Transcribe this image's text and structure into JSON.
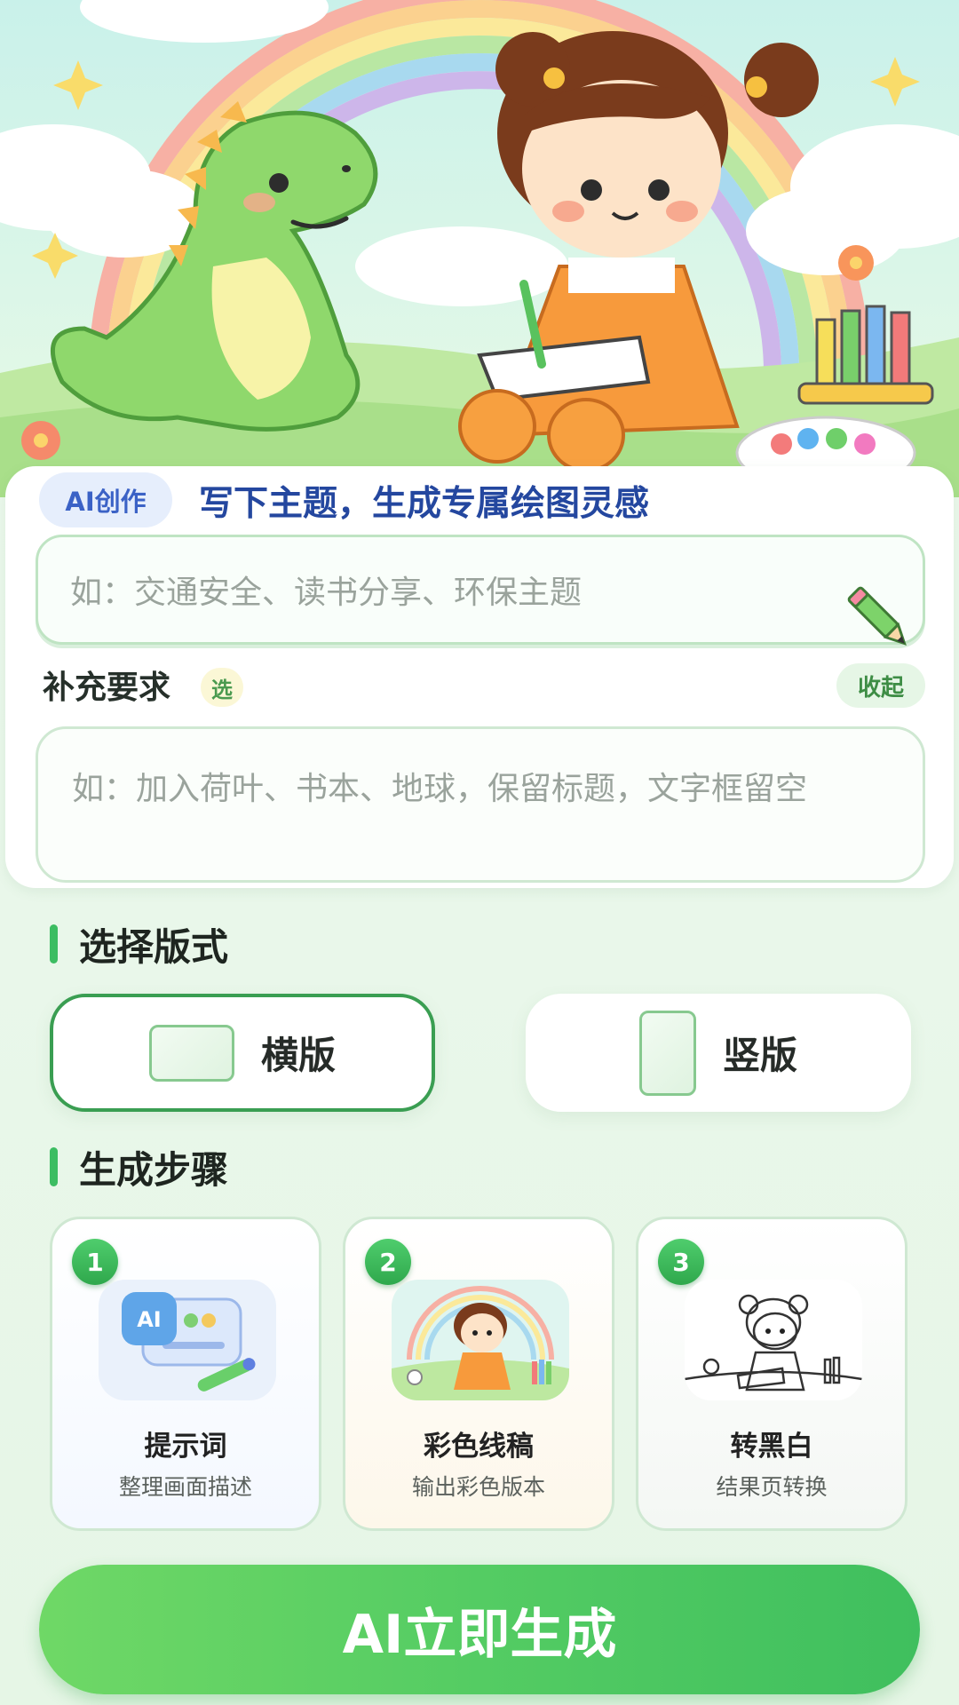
{
  "hero": {
    "scene": "cartoon-dinosaur-girl-drawing-rainbow"
  },
  "card": {
    "chip_label": "AI创作",
    "title": "写下主题，生成专属绘图灵感",
    "topic_placeholder": "如：交通安全、读书分享、环保主题",
    "extra_label": "补充要求",
    "optional_badge": "选",
    "collapse_label": "收起",
    "extra_placeholder": "如：加入荷叶、书本、地球，保留标题，文字框留空"
  },
  "layout_section": {
    "title": "选择版式",
    "options": [
      {
        "label": "横版",
        "selected": true
      },
      {
        "label": "竖版",
        "selected": false
      }
    ]
  },
  "steps_section": {
    "title": "生成步骤",
    "steps": [
      {
        "num": "1",
        "title": "提示词",
        "subtitle": "整理画面描述",
        "icon": "ai-prompt-icon",
        "ai_text": "AI"
      },
      {
        "num": "2",
        "title": "彩色线稿",
        "subtitle": "输出彩色版本",
        "icon": "color-drawing-thumbnail"
      },
      {
        "num": "3",
        "title": "转黑白",
        "subtitle": "结果页转换",
        "icon": "bw-drawing-thumbnail"
      }
    ]
  },
  "cta": {
    "label": "AI立即生成"
  },
  "colors": {
    "accent_green": "#3cbd62",
    "title_blue": "#24479f",
    "chip_blue": "#3b62c6"
  }
}
